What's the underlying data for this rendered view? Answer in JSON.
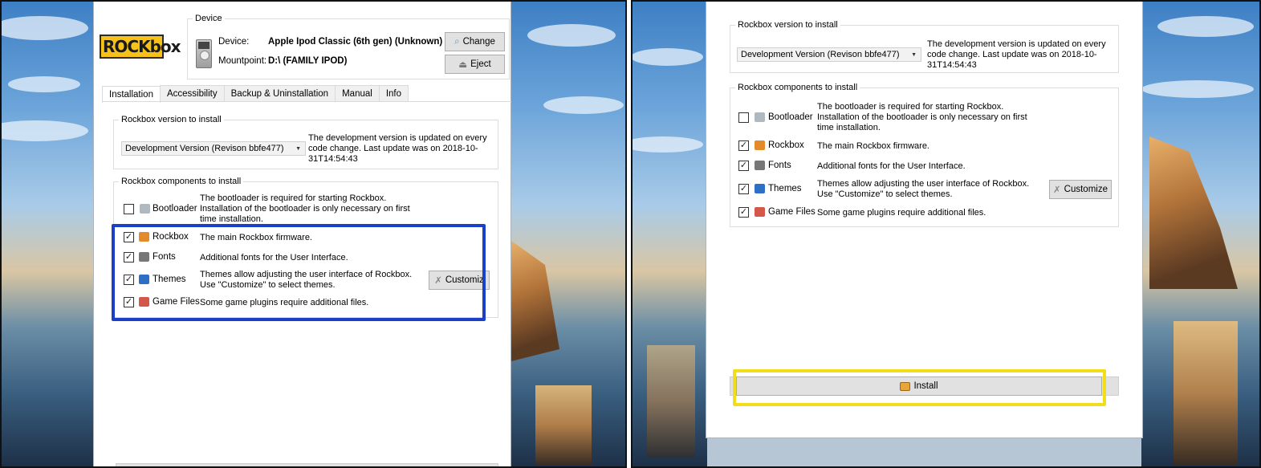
{
  "device": {
    "group_title": "Device",
    "logo_text": "ROCKbox",
    "device_label": "Device:",
    "device_value": "Apple Ipod Classic (6th gen) (Unknown)",
    "mountpoint_label": "Mountpoint:",
    "mountpoint_value": "D:\\ (FAMILY IPOD)",
    "change_label": "Change",
    "eject_label": "Eject"
  },
  "tabs": [
    {
      "label": "Installation",
      "active": true
    },
    {
      "label": "Accessibility"
    },
    {
      "label": "Backup & Uninstallation"
    },
    {
      "label": "Manual"
    },
    {
      "label": "Info"
    }
  ],
  "version": {
    "group_title": "Rockbox version to install",
    "selected": "Development Version (Revison bbfe477)",
    "description": "The development version is updated on every code change. Last update was on 2018-10-31T14:54:43"
  },
  "components": {
    "group_title": "Rockbox components to install",
    "items": [
      {
        "name": "Bootloader",
        "checked": false,
        "icon": "tools-icon",
        "description": "The bootloader is required for starting Rockbox. Installation of the bootloader is only necessary on first time installation."
      },
      {
        "name": "Rockbox",
        "checked": true,
        "icon": "rockbox-icon",
        "description": "The main Rockbox firmware."
      },
      {
        "name": "Fonts",
        "checked": true,
        "icon": "fonts-icon",
        "description": "Additional fonts for the User Interface."
      },
      {
        "name": "Themes",
        "checked": true,
        "icon": "themes-icon",
        "description": "Themes allow adjusting the user interface of Rockbox. Use \"Customize\" to select themes."
      },
      {
        "name": "Game Files",
        "checked": true,
        "icon": "game-icon",
        "description": "Some game plugins require additional files."
      }
    ],
    "customize_label": "Customize",
    "customize_label_clipped": "Customiz"
  },
  "install_label": "Install",
  "colors": {
    "highlight_blue": "#1c3fc8",
    "highlight_yellow": "#f2dd1a"
  }
}
